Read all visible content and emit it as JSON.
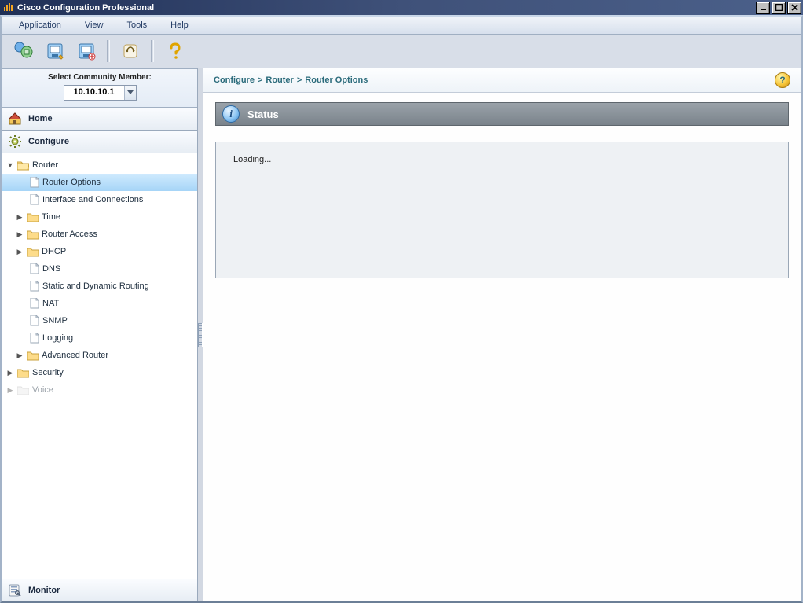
{
  "window": {
    "title": "Cisco Configuration Professional"
  },
  "menubar": {
    "items": [
      "Application",
      "View",
      "Tools",
      "Help"
    ]
  },
  "community": {
    "label": "Select Community Member:",
    "selected": "10.10.10.1"
  },
  "primary_nav": {
    "home": "Home",
    "configure": "Configure",
    "monitor": "Monitor"
  },
  "tree": {
    "router": {
      "label": "Router",
      "items": {
        "router_options": "Router Options",
        "interface_connections": "Interface and Connections",
        "time": "Time",
        "router_access": "Router Access",
        "dhcp": "DHCP",
        "dns": "DNS",
        "static_dynamic_routing": "Static and Dynamic Routing",
        "nat": "NAT",
        "snmp": "SNMP",
        "logging": "Logging",
        "advanced_router": "Advanced Router"
      }
    },
    "security": {
      "label": "Security"
    },
    "voice": {
      "label": "Voice"
    }
  },
  "breadcrumb": {
    "parts": [
      "Configure",
      "Router",
      "Router Options"
    ],
    "separator": ">"
  },
  "main": {
    "panel_title": "Status",
    "body_text": "Loading..."
  }
}
